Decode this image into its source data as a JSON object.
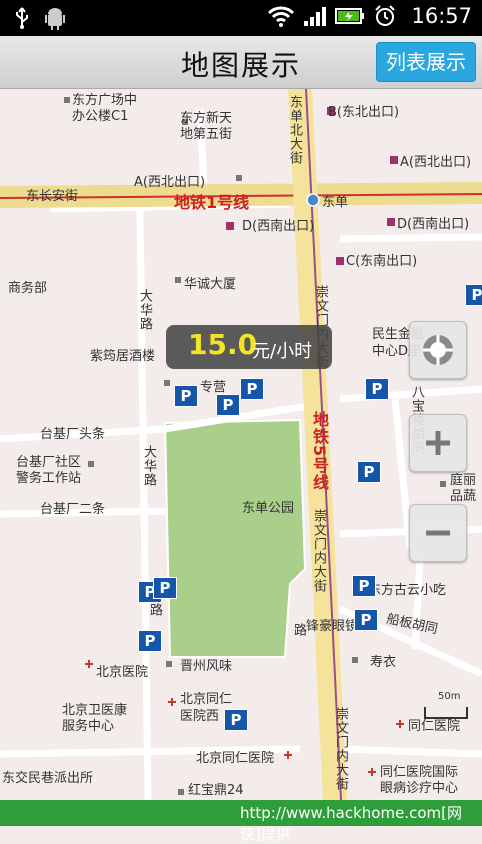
{
  "status_bar": {
    "time": "16:57"
  },
  "header": {
    "title": "地图展示",
    "list_button": "列表展示"
  },
  "price_bubble": {
    "price": "15.0",
    "unit": "元/小时"
  },
  "map_labels": {
    "l1": "东方广场中",
    "l2": "办公楼C1",
    "l3": "东方新天",
    "l4": "地第五街",
    "l5": "B(东北出口)",
    "l6": "A(西北出口)",
    "l7": "A(西北出口)",
    "l8": "东长安街",
    "l9": "地铁1号线",
    "l10": "东单",
    "l11": "D(西南出口)",
    "l12": "D(西南出口)",
    "l13": "C(东南出口)",
    "l14": "商务部",
    "l15": "华诚大厦",
    "l16": "紫筠居酒楼",
    "l17": "民生金融",
    "l18": "中心D座",
    "l19": "专营",
    "l20": "台基厂头条",
    "l21": "台基厂社区",
    "l22": "警务工作站",
    "l23": "台基厂二条",
    "l24": "东单公园",
    "l25": "庭丽",
    "l26": "品蔬",
    "l27": "东方古云小吃",
    "l28": "锋豪眼镜",
    "l29": "船板胡同",
    "l30": "寿衣",
    "l31": "北京医院",
    "l32": "晋州风味",
    "l33": "北京卫医康",
    "l34": "服务中心",
    "l35": "北京同仁",
    "l36": "医院西",
    "l37": "北京同仁医院",
    "l38": "同仁医院",
    "l39": "东交民巷派出所",
    "l40": "红宝鼎24",
    "l41": "同仁医院国际",
    "l42": "眼病诊疗中心",
    "scale": "50m",
    "v1": "东单北大街",
    "v2": "大华路",
    "v3": "大华路",
    "v4": "崇文门内大街",
    "v5": "地铁5号线",
    "v6": "崇文门内大街",
    "v7": "崇文门内大街",
    "v8": "八宝楼胡同",
    "v9": "路",
    "v10": "路"
  },
  "parking_symbol": "P",
  "footer": {
    "text": "http://www.hackhome.com[网侠]提供"
  }
}
